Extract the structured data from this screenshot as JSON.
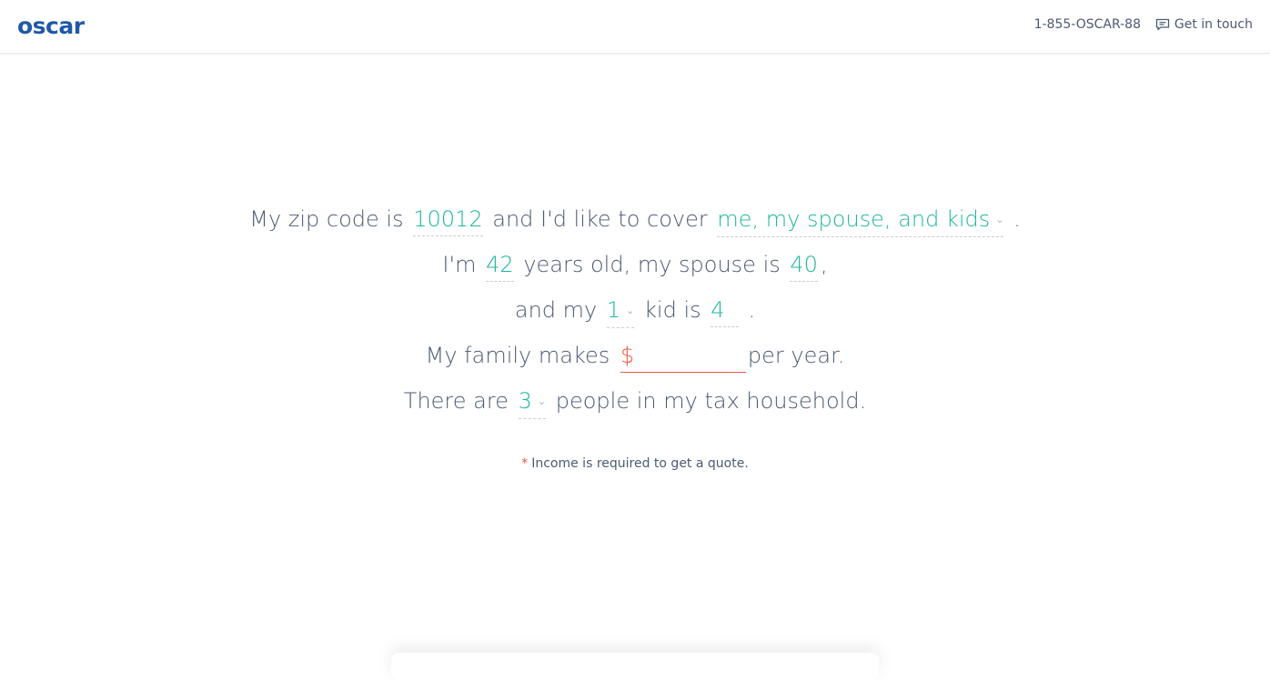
{
  "header": {
    "logo": "oscar",
    "phone": "1-855-OSCAR-88",
    "contact_label": "Get in touch",
    "contact_icon": "chat-icon"
  },
  "form": {
    "line1": {
      "prefix": "My zip code is",
      "zip": "10012",
      "middle": "and I'd like to cover",
      "coverage": "me, my spouse, and kids",
      "suffix": "."
    },
    "line2": {
      "prefix": "I'm",
      "my_age": "42",
      "middle": "years old, my spouse is",
      "spouse_age": "40",
      "suffix": ","
    },
    "line3": {
      "prefix": "and my",
      "kid_count": "1",
      "middle": "kid is",
      "kid_age": "4",
      "suffix": "."
    },
    "line4": {
      "prefix": "My family makes",
      "income_prefix": "$",
      "income_value": "",
      "suffix": "per year."
    },
    "line5": {
      "prefix": "There are",
      "household": "3",
      "suffix": "people in my tax household."
    }
  },
  "note": {
    "star": "*",
    "text": "Income is required to get a quote."
  },
  "colors": {
    "accent": "#1fb79d",
    "error": "#ea5a45",
    "brand": "#1f59a8",
    "text": "#4c5a73"
  }
}
